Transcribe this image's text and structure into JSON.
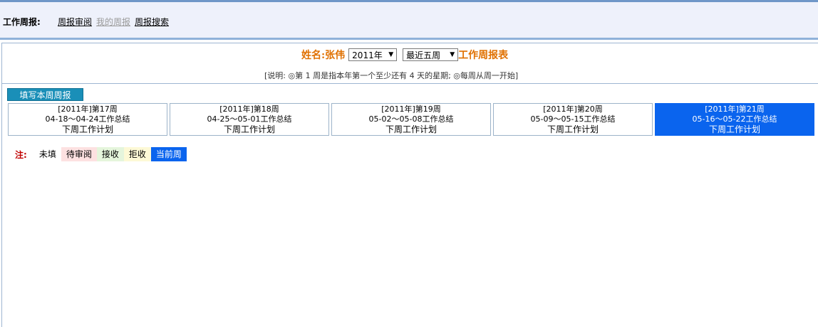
{
  "nav": {
    "title": "工作周报:",
    "links": [
      {
        "label": "周报审阅",
        "state": "active"
      },
      {
        "label": "我的周报",
        "state": "disabled"
      },
      {
        "label": "周报搜索",
        "state": "active"
      }
    ]
  },
  "header": {
    "name_label": "姓名:张伟",
    "year_value": "2011年",
    "range_value": "最近五周",
    "suffix": "工作周报表",
    "note": "[说明: ◎第 1 周是指本年第一个至少还有 4 天的星期; ◎每周从周一开始]"
  },
  "fill_button": "填写本周周报",
  "weeks": [
    {
      "title": "[2011年]第17周",
      "summary": "04-18～04-24工作总结",
      "plan": "下周工作计划",
      "status": "unfilled"
    },
    {
      "title": "[2011年]第18周",
      "summary": "04-25～05-01工作总结",
      "plan": "下周工作计划",
      "status": "unfilled"
    },
    {
      "title": "[2011年]第19周",
      "summary": "05-02～05-08工作总结",
      "plan": "下周工作计划",
      "status": "unfilled"
    },
    {
      "title": "[2011年]第20周",
      "summary": "05-09～05-15工作总结",
      "plan": "下周工作计划",
      "status": "unfilled"
    },
    {
      "title": "[2011年]第21周",
      "summary": "05-16～05-22工作总结",
      "plan": "下周工作计划",
      "status": "current"
    }
  ],
  "legend": {
    "label": "注:",
    "items": [
      {
        "label": "未填",
        "bg": "#ffffff",
        "fg": "#000000"
      },
      {
        "label": "待审阅",
        "bg": "#fde1e1",
        "fg": "#000000"
      },
      {
        "label": "接收",
        "bg": "#e5f5dc",
        "fg": "#000000"
      },
      {
        "label": "拒收",
        "bg": "#fdf9d6",
        "fg": "#000000"
      },
      {
        "label": "当前周",
        "bg": "#0a64ee",
        "fg": "#ffffff"
      }
    ]
  }
}
